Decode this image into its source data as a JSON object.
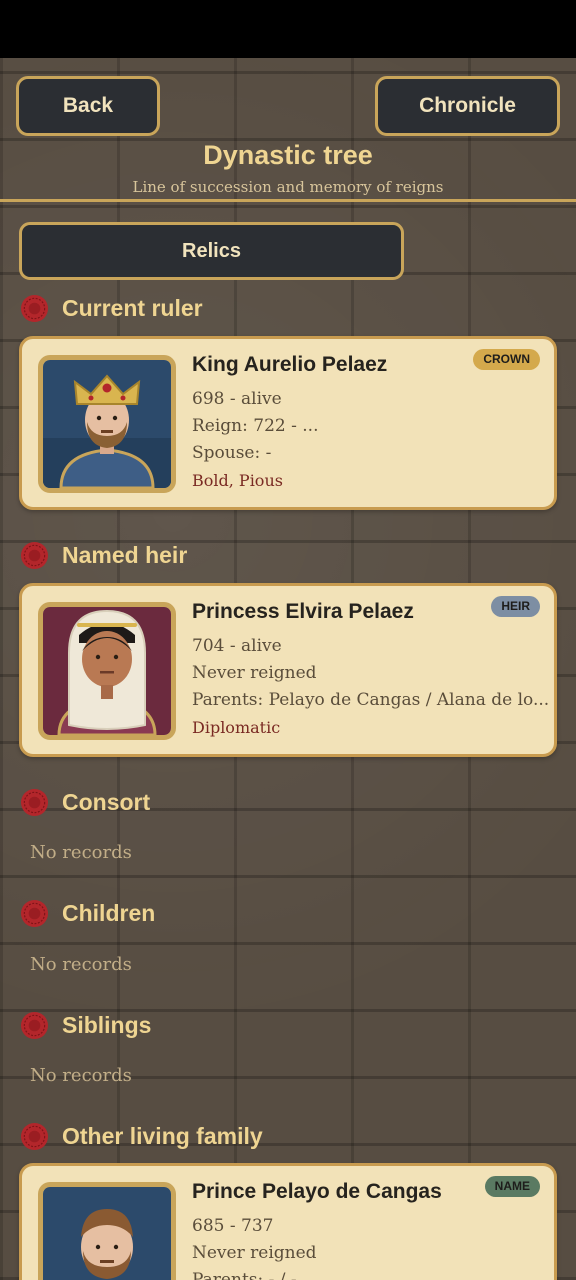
{
  "header": {
    "back_label": "Back",
    "chronicle_label": "Chronicle",
    "title": "Dynastic tree",
    "subtitle": "Line of succession and memory of reigns"
  },
  "relics_label": "Relics",
  "sections": {
    "current_ruler": "Current ruler",
    "named_heir": "Named heir",
    "consort": "Consort",
    "children": "Children",
    "siblings": "Siblings",
    "other_family": "Other living family"
  },
  "empty_text": "No records",
  "cards": {
    "ruler": {
      "name": "King Aurelio Pelaez",
      "badge": "CROWN",
      "line1": "698 - alive",
      "line2": "Reign: 722 - ...",
      "line3": "Spouse: -",
      "traits": "Bold, Pious"
    },
    "heir": {
      "name": "Princess Elvira Pelaez",
      "badge": "HEIR",
      "line1": "704 - alive",
      "line2": "Never reigned",
      "line3": "Parents: Pelayo de Cangas / Alana de lo...",
      "traits": "Diplomatic"
    },
    "other": {
      "name": "Prince Pelayo de Cangas",
      "badge": "NAME",
      "line1": "685 - 737",
      "line2": "Never reigned",
      "line3": "Parents: - / -"
    }
  },
  "colors": {
    "accent_gold": "#c9a55a",
    "badge_crown": "#d4a94c",
    "badge_heir": "#7d8ea3",
    "badge_name": "#5a7a62",
    "section_icon": "#b3262b"
  },
  "icons": {
    "section": "crimson-seal-icon",
    "ruler_portrait": "king-portrait",
    "heir_portrait": "princess-portrait",
    "other_portrait": "prince-portrait"
  }
}
